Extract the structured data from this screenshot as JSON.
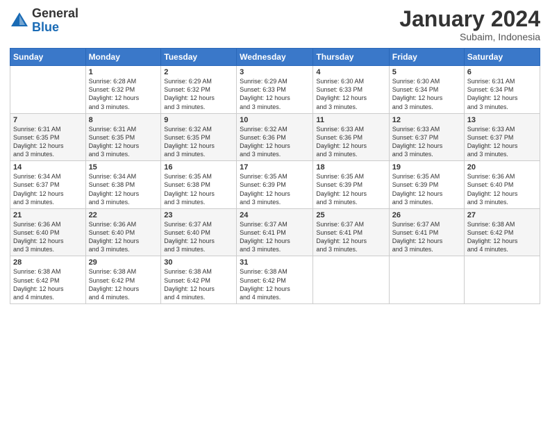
{
  "logo": {
    "general": "General",
    "blue": "Blue"
  },
  "header": {
    "title": "January 2024",
    "subtitle": "Subaim, Indonesia"
  },
  "days_of_week": [
    "Sunday",
    "Monday",
    "Tuesday",
    "Wednesday",
    "Thursday",
    "Friday",
    "Saturday"
  ],
  "weeks": [
    [
      {
        "num": "",
        "info": ""
      },
      {
        "num": "1",
        "info": "Sunrise: 6:28 AM\nSunset: 6:32 PM\nDaylight: 12 hours\nand 3 minutes."
      },
      {
        "num": "2",
        "info": "Sunrise: 6:29 AM\nSunset: 6:32 PM\nDaylight: 12 hours\nand 3 minutes."
      },
      {
        "num": "3",
        "info": "Sunrise: 6:29 AM\nSunset: 6:33 PM\nDaylight: 12 hours\nand 3 minutes."
      },
      {
        "num": "4",
        "info": "Sunrise: 6:30 AM\nSunset: 6:33 PM\nDaylight: 12 hours\nand 3 minutes."
      },
      {
        "num": "5",
        "info": "Sunrise: 6:30 AM\nSunset: 6:34 PM\nDaylight: 12 hours\nand 3 minutes."
      },
      {
        "num": "6",
        "info": "Sunrise: 6:31 AM\nSunset: 6:34 PM\nDaylight: 12 hours\nand 3 minutes."
      }
    ],
    [
      {
        "num": "7",
        "info": "Sunrise: 6:31 AM\nSunset: 6:35 PM\nDaylight: 12 hours\nand 3 minutes."
      },
      {
        "num": "8",
        "info": "Sunrise: 6:31 AM\nSunset: 6:35 PM\nDaylight: 12 hours\nand 3 minutes."
      },
      {
        "num": "9",
        "info": "Sunrise: 6:32 AM\nSunset: 6:35 PM\nDaylight: 12 hours\nand 3 minutes."
      },
      {
        "num": "10",
        "info": "Sunrise: 6:32 AM\nSunset: 6:36 PM\nDaylight: 12 hours\nand 3 minutes."
      },
      {
        "num": "11",
        "info": "Sunrise: 6:33 AM\nSunset: 6:36 PM\nDaylight: 12 hours\nand 3 minutes."
      },
      {
        "num": "12",
        "info": "Sunrise: 6:33 AM\nSunset: 6:37 PM\nDaylight: 12 hours\nand 3 minutes."
      },
      {
        "num": "13",
        "info": "Sunrise: 6:33 AM\nSunset: 6:37 PM\nDaylight: 12 hours\nand 3 minutes."
      }
    ],
    [
      {
        "num": "14",
        "info": "Sunrise: 6:34 AM\nSunset: 6:37 PM\nDaylight: 12 hours\nand 3 minutes."
      },
      {
        "num": "15",
        "info": "Sunrise: 6:34 AM\nSunset: 6:38 PM\nDaylight: 12 hours\nand 3 minutes."
      },
      {
        "num": "16",
        "info": "Sunrise: 6:35 AM\nSunset: 6:38 PM\nDaylight: 12 hours\nand 3 minutes."
      },
      {
        "num": "17",
        "info": "Sunrise: 6:35 AM\nSunset: 6:39 PM\nDaylight: 12 hours\nand 3 minutes."
      },
      {
        "num": "18",
        "info": "Sunrise: 6:35 AM\nSunset: 6:39 PM\nDaylight: 12 hours\nand 3 minutes."
      },
      {
        "num": "19",
        "info": "Sunrise: 6:35 AM\nSunset: 6:39 PM\nDaylight: 12 hours\nand 3 minutes."
      },
      {
        "num": "20",
        "info": "Sunrise: 6:36 AM\nSunset: 6:40 PM\nDaylight: 12 hours\nand 3 minutes."
      }
    ],
    [
      {
        "num": "21",
        "info": "Sunrise: 6:36 AM\nSunset: 6:40 PM\nDaylight: 12 hours\nand 3 minutes."
      },
      {
        "num": "22",
        "info": "Sunrise: 6:36 AM\nSunset: 6:40 PM\nDaylight: 12 hours\nand 3 minutes."
      },
      {
        "num": "23",
        "info": "Sunrise: 6:37 AM\nSunset: 6:40 PM\nDaylight: 12 hours\nand 3 minutes."
      },
      {
        "num": "24",
        "info": "Sunrise: 6:37 AM\nSunset: 6:41 PM\nDaylight: 12 hours\nand 3 minutes."
      },
      {
        "num": "25",
        "info": "Sunrise: 6:37 AM\nSunset: 6:41 PM\nDaylight: 12 hours\nand 3 minutes."
      },
      {
        "num": "26",
        "info": "Sunrise: 6:37 AM\nSunset: 6:41 PM\nDaylight: 12 hours\nand 3 minutes."
      },
      {
        "num": "27",
        "info": "Sunrise: 6:38 AM\nSunset: 6:42 PM\nDaylight: 12 hours\nand 4 minutes."
      }
    ],
    [
      {
        "num": "28",
        "info": "Sunrise: 6:38 AM\nSunset: 6:42 PM\nDaylight: 12 hours\nand 4 minutes."
      },
      {
        "num": "29",
        "info": "Sunrise: 6:38 AM\nSunset: 6:42 PM\nDaylight: 12 hours\nand 4 minutes."
      },
      {
        "num": "30",
        "info": "Sunrise: 6:38 AM\nSunset: 6:42 PM\nDaylight: 12 hours\nand 4 minutes."
      },
      {
        "num": "31",
        "info": "Sunrise: 6:38 AM\nSunset: 6:42 PM\nDaylight: 12 hours\nand 4 minutes."
      },
      {
        "num": "",
        "info": ""
      },
      {
        "num": "",
        "info": ""
      },
      {
        "num": "",
        "info": ""
      }
    ]
  ]
}
